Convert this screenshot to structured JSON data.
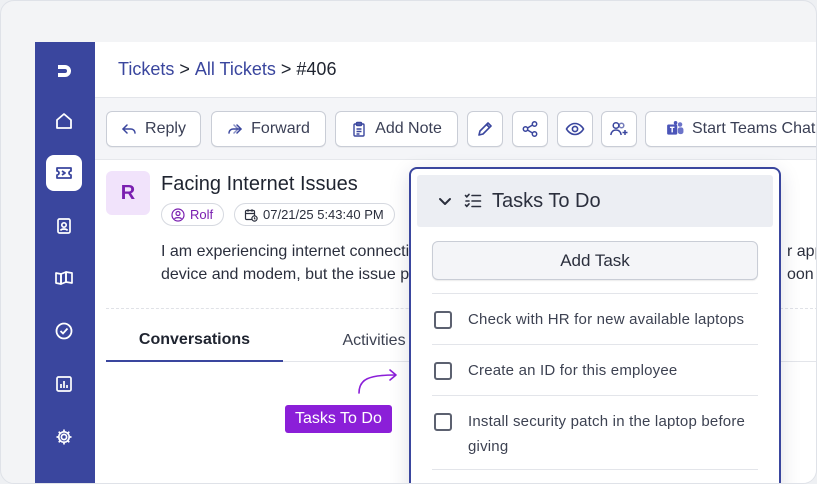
{
  "breadcrumb": {
    "item1": "Tickets",
    "sep1": ">",
    "item2": "All Tickets",
    "sep2": ">",
    "current": "#406"
  },
  "sidebar": {
    "items": [
      {
        "name": "logo",
        "icon": "logo-icon"
      },
      {
        "name": "home",
        "icon": "home-icon"
      },
      {
        "name": "tickets",
        "icon": "ticket-icon",
        "active": true
      },
      {
        "name": "contacts",
        "icon": "contacts-icon"
      },
      {
        "name": "knowledge-base",
        "icon": "book-icon"
      },
      {
        "name": "tasks",
        "icon": "check-circle-icon"
      },
      {
        "name": "reports",
        "icon": "chart-icon"
      },
      {
        "name": "settings",
        "icon": "gear-icon"
      }
    ]
  },
  "toolbar": {
    "reply": "Reply",
    "forward": "Forward",
    "add_note": "Add Note",
    "start_teams_chat": "Start Teams Chat"
  },
  "ticket": {
    "avatar_initial": "R",
    "title": "Facing Internet Issues",
    "user": "Rolf",
    "datetime": "07/21/25 5:43:40 PM",
    "description_line1": "I am experiencing internet connectiv",
    "description_line2": "device and modem, but the issue pe",
    "description_right1": "r appl",
    "description_right2": "oon as"
  },
  "tabs": {
    "conversations": "Conversations",
    "activities": "Activities"
  },
  "callout": {
    "label": "Tasks To Do"
  },
  "tasks_panel": {
    "title": "Tasks To Do",
    "add_task": "Add Task",
    "tasks": [
      {
        "line1": "Check with HR for new available laptops",
        "line2": "",
        "checked": false
      },
      {
        "line1": "Create an ID for this employee",
        "line2": "",
        "checked": false
      },
      {
        "line1": "Install security patch in the laptop before",
        "line2": "giving",
        "checked": false
      }
    ]
  },
  "colors": {
    "brand": "#3a469e",
    "accent_purple": "#8b1fd8",
    "avatar_bg": "#f1e3fb"
  }
}
